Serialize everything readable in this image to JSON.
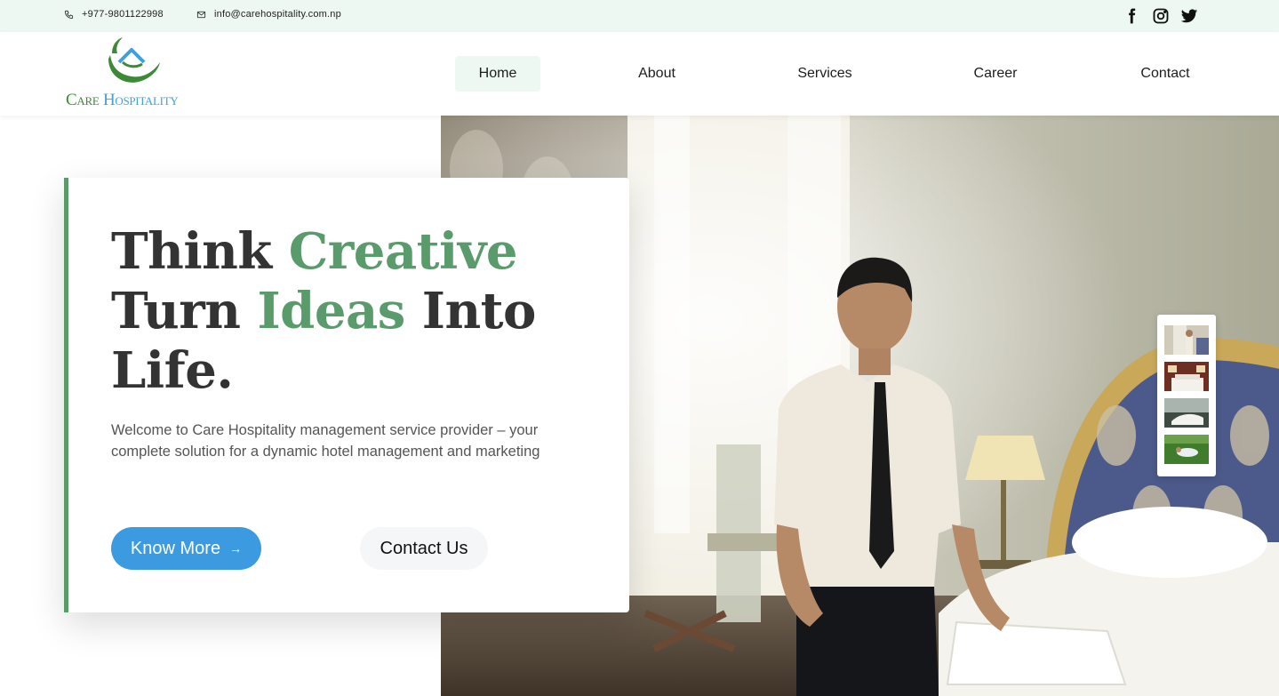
{
  "topbar": {
    "phone": "+977-9801122998",
    "email": "info@carehospitality.com.np",
    "social": [
      "facebook-icon",
      "instagram-icon",
      "twitter-icon"
    ]
  },
  "logo": {
    "word1": "Care",
    "word2": "Hospitality"
  },
  "nav": {
    "items": [
      {
        "label": "Home",
        "active": true
      },
      {
        "label": "About",
        "active": false
      },
      {
        "label": "Services",
        "active": false
      },
      {
        "label": "Career",
        "active": false
      },
      {
        "label": "Contact",
        "active": false
      }
    ]
  },
  "hero": {
    "headline": {
      "w1": "Think",
      "w2": "Creative",
      "w3": "Turn",
      "w4": "Ideas",
      "w5": "Into",
      "w6": "Life."
    },
    "welcome": "Welcome to Care Hospitality management service provider – your complete solution for a dynamic hotel management and marketing",
    "primary_button": "Know More",
    "primary_arrow": "→",
    "secondary_button": "Contact Us",
    "thumbnail_count": 4
  },
  "colors": {
    "accent_green": "#5a9b6c",
    "brand_blue": "#3c9be0",
    "topbar_bg": "#ecf8f1",
    "text_dark": "#333333"
  }
}
